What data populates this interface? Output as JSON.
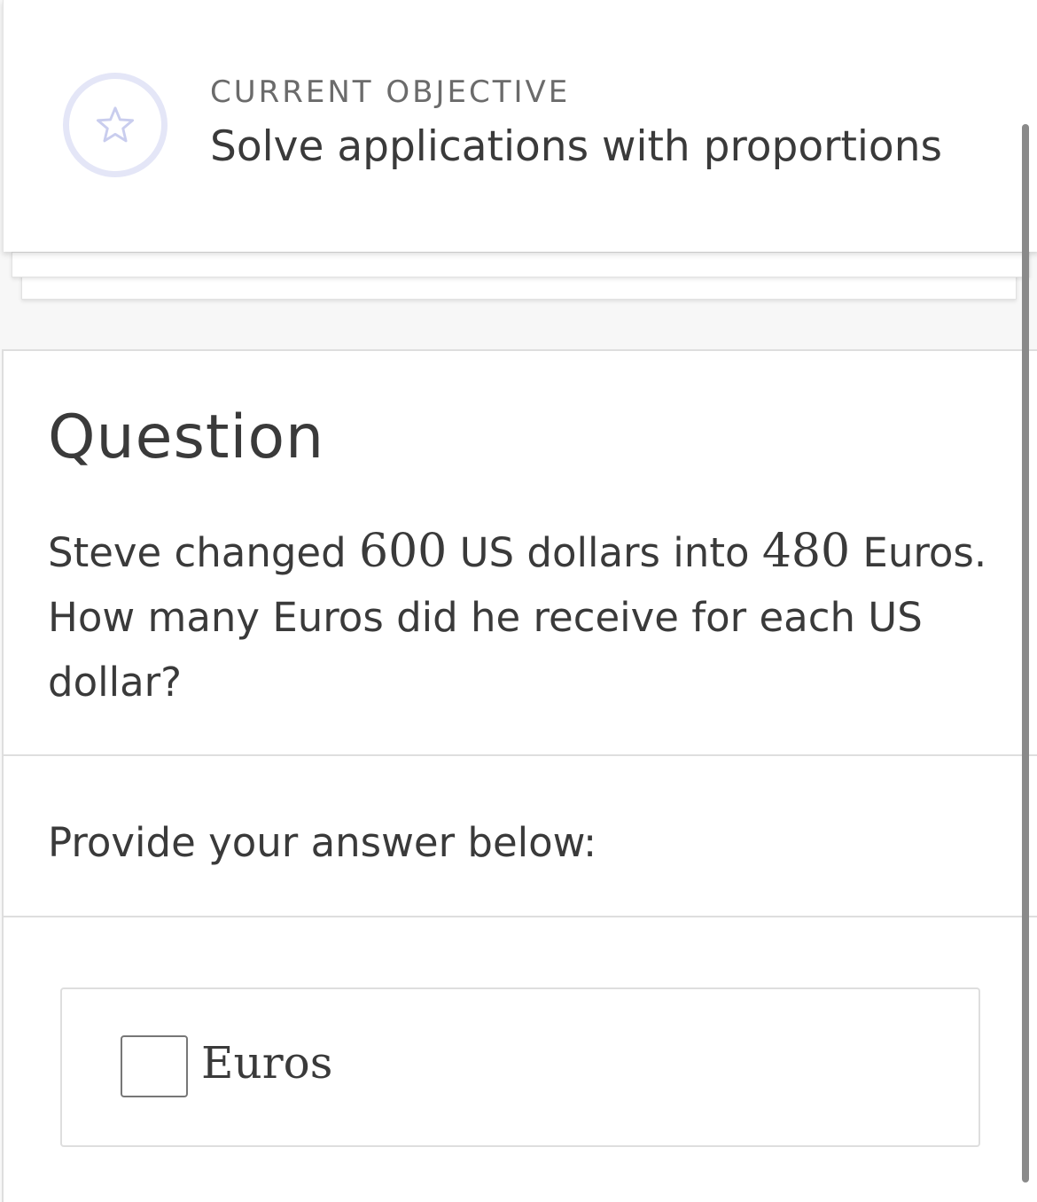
{
  "objective": {
    "icon": "star-icon",
    "label": "CURRENT OBJECTIVE",
    "title": "Solve applications with proportions"
  },
  "question": {
    "heading": "Question",
    "text_part1": "Steve changed ",
    "amount_usd": "600",
    "text_part2": " US dollars into ",
    "amount_eur": "480",
    "text_part3": " Euros. How many Euros did he receive for each US dollar?"
  },
  "answer": {
    "prompt": "Provide your answer below:",
    "input_value": "",
    "unit": "Euros"
  },
  "colors": {
    "badge_ring": "#e4e6f7",
    "star": "#c9cdee",
    "text": "#3a3a3a",
    "muted": "#6b6b6b"
  }
}
